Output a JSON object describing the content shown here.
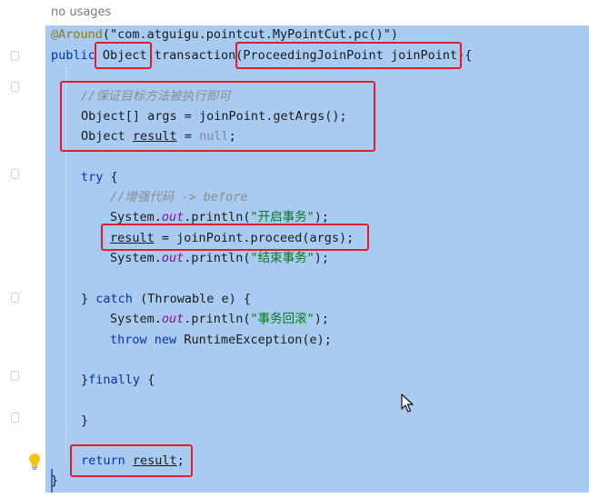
{
  "hint": "no usages",
  "colors": {
    "selection": "#a9cbf2",
    "highlight_box": "#e31b2a",
    "keyword": "#0033b3",
    "string": "#067d17",
    "comment": "#8c8c8c",
    "annotation": "#8a7a1c"
  },
  "code": {
    "annotation": "@Around",
    "annotation_arg": "(\"com.atguigu.pointcut.MyPointCut.pc()\")",
    "sig_public": "public",
    "sig_return": "Object",
    "sig_name": "transaction",
    "sig_param": "ProceedingJoinPoint joinPoint",
    "comment1": "//保证目标方法被执行即可",
    "args_decl": "Object[] args = joinPoint.getArgs();",
    "result_type": "Object",
    "result_var": "result",
    "result_eq": "=",
    "null_kw": "null",
    "semicolon": ";",
    "try_kw": "try",
    "open_brace": "{",
    "comment2": "//增强代码 -> before",
    "sys": "System.",
    "out": "out",
    "println": ".println(",
    "msg_begin": "\"开启事务\"",
    "close_paren": ");",
    "proceed_call": "= joinPoint.proceed(args);",
    "msg_end": "\"结束事务\"",
    "catch_close": "}",
    "catch_kw": "catch",
    "catch_param": "(Throwable e) {",
    "msg_rollback": "\"事务回滚\"",
    "throw_kw": "throw",
    "new_kw": "new",
    "throw_rest": "RuntimeException(e);",
    "finally_close": "}",
    "finally_kw": "finally",
    "finally_brace": "{",
    "block_close": "}",
    "return_kw": "return",
    "method_close": "}"
  },
  "icons": {
    "bulb": "lightbulb-icon",
    "cursor": "mouse-cursor-icon"
  }
}
